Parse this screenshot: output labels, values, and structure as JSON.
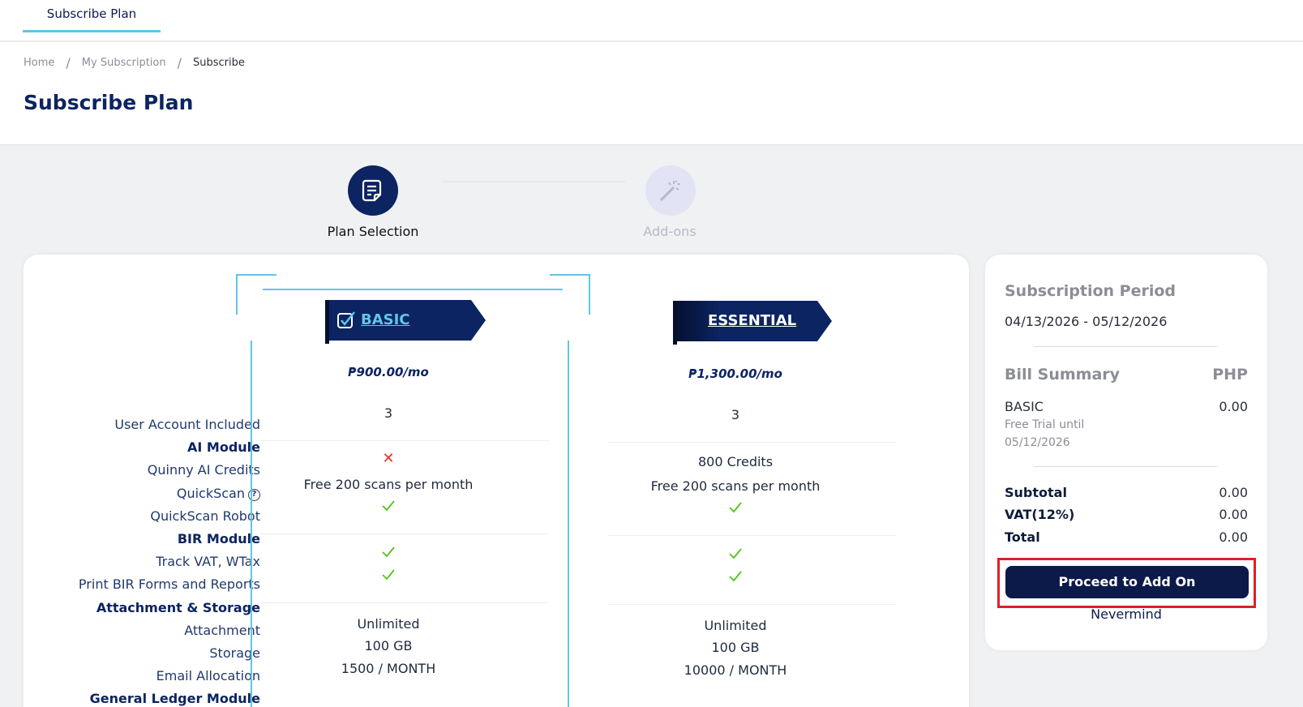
{
  "topbar": {
    "tab_label": "Subscribe Plan"
  },
  "breadcrumb": {
    "items": [
      "Home",
      "My Subscription",
      "Subscribe"
    ],
    "separator": "/"
  },
  "page": {
    "title": "Subscribe Plan"
  },
  "stepper": {
    "steps": [
      {
        "label": "Plan Selection",
        "icon": "document-icon",
        "state": "active"
      },
      {
        "label": "Add-ons",
        "icon": "magic-wand-icon",
        "state": "inactive"
      }
    ]
  },
  "features": [
    {
      "label": "User Account Included",
      "module": false
    },
    {
      "label": "AI Module",
      "module": true
    },
    {
      "label": "Quinny AI Credits",
      "module": false
    },
    {
      "label": "QuickScan",
      "module": false,
      "help": "?"
    },
    {
      "label": "QuickScan Robot",
      "module": false
    },
    {
      "label": "BIR Module",
      "module": true
    },
    {
      "label": "Track VAT, WTax",
      "module": false
    },
    {
      "label": "Print BIR Forms and Reports",
      "module": false
    },
    {
      "label": "Attachment & Storage",
      "module": true
    },
    {
      "label": "Attachment",
      "module": false
    },
    {
      "label": "Storage",
      "module": false
    },
    {
      "label": "Email Allocation",
      "module": false
    },
    {
      "label": "General Ledger Module",
      "module": true
    }
  ],
  "plans": {
    "basic": {
      "name": "BASIC",
      "price": "₱900.00/mo",
      "users": "3",
      "quinny_credits_mark": "✕",
      "quickscan": "Free 200 scans per month",
      "attachment": "Unlimited",
      "storage": "100 GB",
      "email": "1500 / MONTH"
    },
    "essential": {
      "name": "ESSENTIAL",
      "price": "₱1,300.00/mo",
      "users": "3",
      "quinny_credits": "800 Credits",
      "quickscan": "Free 200 scans per month",
      "attachment": "Unlimited",
      "storage": "100 GB",
      "email": "10000 / MONTH"
    }
  },
  "summary": {
    "period_heading": "Subscription Period",
    "period": "04/13/2026 - 05/12/2026",
    "bill_heading": "Bill Summary",
    "currency": "PHP",
    "item_name": "BASIC",
    "item_amount": "0.00",
    "trial_line1": "Free Trial until",
    "trial_line2": "05/12/2026",
    "subtotal_label": "Subtotal",
    "subtotal": "0.00",
    "vat_label": "VAT(12%)",
    "vat": "0.00",
    "total_label": "Total",
    "total": "0.00",
    "proceed_label": "Proceed to Add On",
    "nevermind_label": "Nevermind"
  },
  "colors": {
    "navy": "#0c2461",
    "accent": "#5fc6e6",
    "check": "#52c41a",
    "cross": "#e3342f",
    "highlight": "#e01f26"
  }
}
